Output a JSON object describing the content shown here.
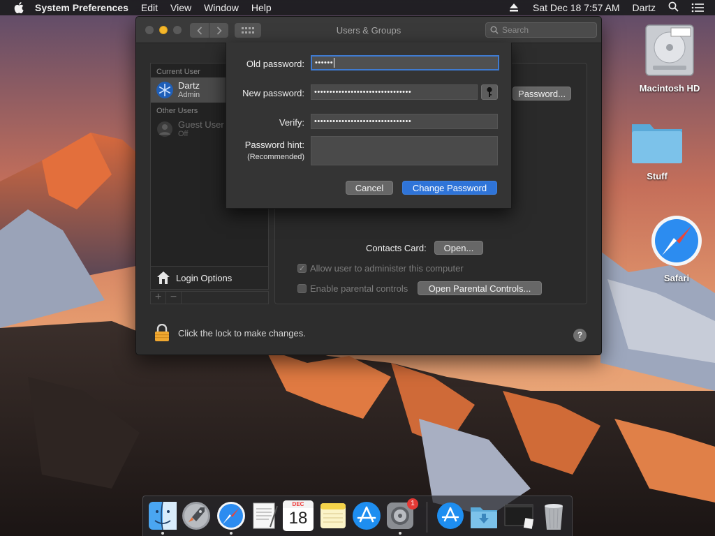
{
  "menubar": {
    "app_name": "System Preferences",
    "menus": [
      "Edit",
      "View",
      "Window",
      "Help"
    ],
    "clock": "Sat Dec 18  7:57 AM",
    "user": "Dartz"
  },
  "desktop": {
    "icons": [
      "Macintosh HD",
      "Stuff",
      "Safari"
    ]
  },
  "window": {
    "title": "Users & Groups",
    "search_placeholder": "Search",
    "sidebar": {
      "current_header": "Current User",
      "current_user": {
        "name": "Dartz",
        "role": "Admin"
      },
      "other_header": "Other Users",
      "other_user": {
        "name": "Guest User",
        "role": "Off"
      },
      "login_options": "Login Options",
      "plus": "+",
      "minus": "−"
    },
    "content": {
      "password_button": "Password...",
      "contacts_label": "Contacts Card:",
      "contacts_button": "Open...",
      "admin_checkbox": "Allow user to administer this computer",
      "parental_checkbox": "Enable parental controls",
      "parental_button": "Open Parental Controls..."
    },
    "lock_text": "Click the lock to make changes.",
    "help": "?"
  },
  "sheet": {
    "old_label": "Old password:",
    "old_value": "••••••",
    "new_label": "New password:",
    "new_value": "••••••••••••••••••••••••••••••••",
    "verify_label": "Verify:",
    "verify_value": "••••••••••••••••••••••••••••••••",
    "hint_label": "Password hint:",
    "hint_sub": "(Recommended)",
    "hint_value": "",
    "cancel": "Cancel",
    "change": "Change Password"
  },
  "dock": {
    "calendar_month": "DEC",
    "calendar_day": "18",
    "badge": "1"
  }
}
